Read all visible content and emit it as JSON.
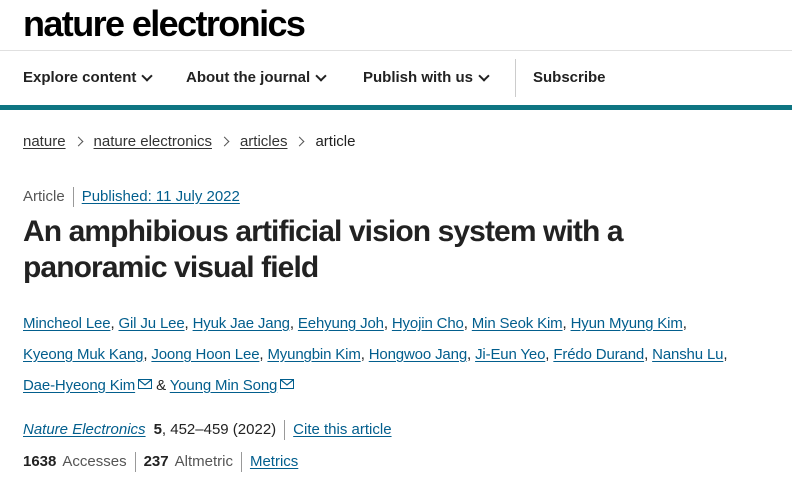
{
  "site": {
    "logo": "nature electronics"
  },
  "nav": {
    "items": [
      {
        "label": "Explore content"
      },
      {
        "label": "About the journal"
      },
      {
        "label": "Publish with us"
      }
    ],
    "subscribe": "Subscribe"
  },
  "breadcrumb": {
    "items": [
      "nature",
      "nature electronics",
      "articles"
    ],
    "current": "article"
  },
  "article": {
    "type": "Article",
    "published": "Published: 11 July 2022",
    "title": "An amphibious artificial vision system with a panoramic visual field",
    "authors": [
      "Mincheol Lee",
      "Gil Ju Lee",
      "Hyuk Jae Jang",
      "Eehyung Joh",
      "Hyojin Cho",
      "Min Seok Kim",
      "Hyun Myung Kim",
      "Kyeong Muk Kang",
      "Joong Hoon Lee",
      "Myungbin Kim",
      "Hongwoo Jang",
      "Ji-Eun Yeo",
      "Frédo Durand",
      "Nanshu Lu",
      "Dae-Hyeong Kim",
      "Young Min Song"
    ],
    "ampersand": "&",
    "journal": "Nature Electronics",
    "volume": "5",
    "pages_year": ", 452–459 (2022)",
    "cite_label": "Cite this article",
    "accesses_count": "1638",
    "accesses_label": "Accesses",
    "altmetric_count": "237",
    "altmetric_label": "Altmetric",
    "metrics_label": "Metrics"
  }
}
